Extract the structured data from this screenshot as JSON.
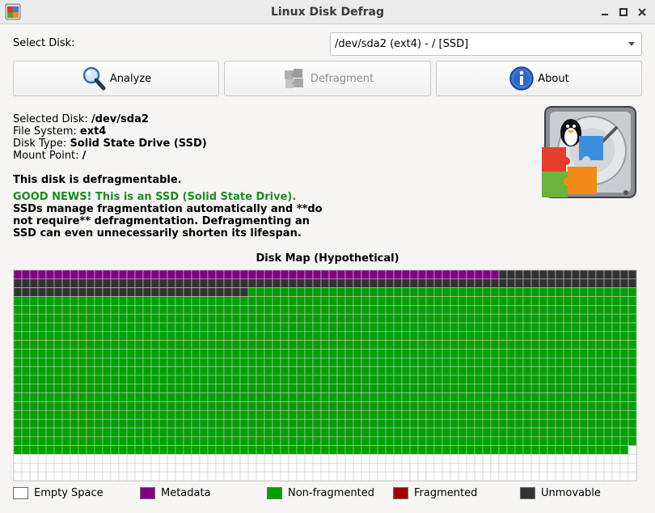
{
  "window": {
    "title": "Linux Disk Defrag"
  },
  "disk_select": {
    "label": "Select Disk:",
    "value": "/dev/sda2 (ext4) - / [SSD]"
  },
  "buttons": {
    "analyze": "Analyze",
    "defragment": "Defragment",
    "about": "About"
  },
  "info": {
    "selected_label": "Selected Disk: ",
    "selected_value": "/dev/sda2",
    "fs_label": "File System: ",
    "fs_value": "ext4",
    "type_label": "Disk Type: ",
    "type_value": "Solid State Drive (SSD)",
    "mount_label": "Mount Point: ",
    "mount_value": "/"
  },
  "status": {
    "defrag": "This disk is defragmentable.",
    "good_news": "GOOD NEWS! This is an SSD (Solid State Drive).",
    "ssd_note": "SSDs manage fragmentation automatically and **do not require** defragmentation. Defragmenting an SSD can even unnecessarily shorten its lifespan."
  },
  "map": {
    "title": "Disk Map (Hypothetical)",
    "columns": 77,
    "rows": 24,
    "blocks": [
      {
        "state": "metadata",
        "count": 60
      },
      {
        "state": "unmovable",
        "count": 123
      },
      {
        "state": "non_fragmented",
        "count": 1433
      },
      {
        "state": "empty",
        "count": 232
      }
    ]
  },
  "colors": {
    "empty": "#ffffff",
    "metadata": "#800080",
    "non_fragmented": "#00a000",
    "fragmented": "#a00000",
    "unmovable": "#333333",
    "grid": "#c8c8c8"
  },
  "legend": [
    {
      "key": "empty",
      "label": "Empty Space"
    },
    {
      "key": "metadata",
      "label": "Metadata"
    },
    {
      "key": "non_fragmented",
      "label": "Non-fragmented"
    },
    {
      "key": "fragmented",
      "label": "Fragmented"
    },
    {
      "key": "unmovable",
      "label": "Unmovable"
    }
  ]
}
